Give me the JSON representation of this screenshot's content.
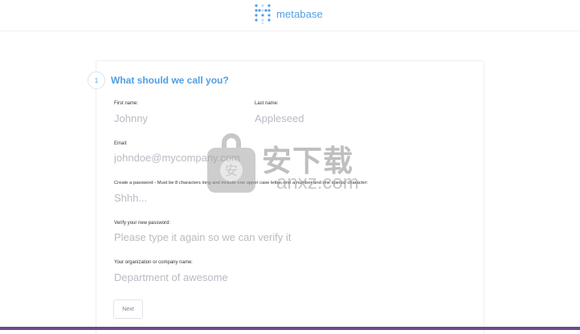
{
  "brand": {
    "name": "metabase",
    "logo_color": "#509ee3"
  },
  "step": {
    "number": "1",
    "title": "What should we call you?"
  },
  "form": {
    "first_name": {
      "label": "First name:",
      "placeholder": "Johnny"
    },
    "last_name": {
      "label": "Last name:",
      "placeholder": "Appleseed"
    },
    "email": {
      "label": "Email:",
      "placeholder": "johndoe@mycompany.com"
    },
    "password": {
      "label": "Create a password - Must be 8 characters long and include one upper case letter, one a number and one special character:",
      "placeholder": "Shhh..."
    },
    "confirm_password": {
      "label": "Verify your new password:",
      "placeholder": "Please type it again so we can verify it"
    },
    "organization": {
      "label": "Your organization or company name:",
      "placeholder": "Department of awesome"
    },
    "next_label": "Next"
  },
  "watermark": {
    "text": "安下载",
    "subtext": "anxz.com"
  },
  "colors": {
    "accent": "#509ee3",
    "placeholder": "#b8bbc3",
    "border": "#eeeff1",
    "bottom_bar": "#6a4b93"
  }
}
